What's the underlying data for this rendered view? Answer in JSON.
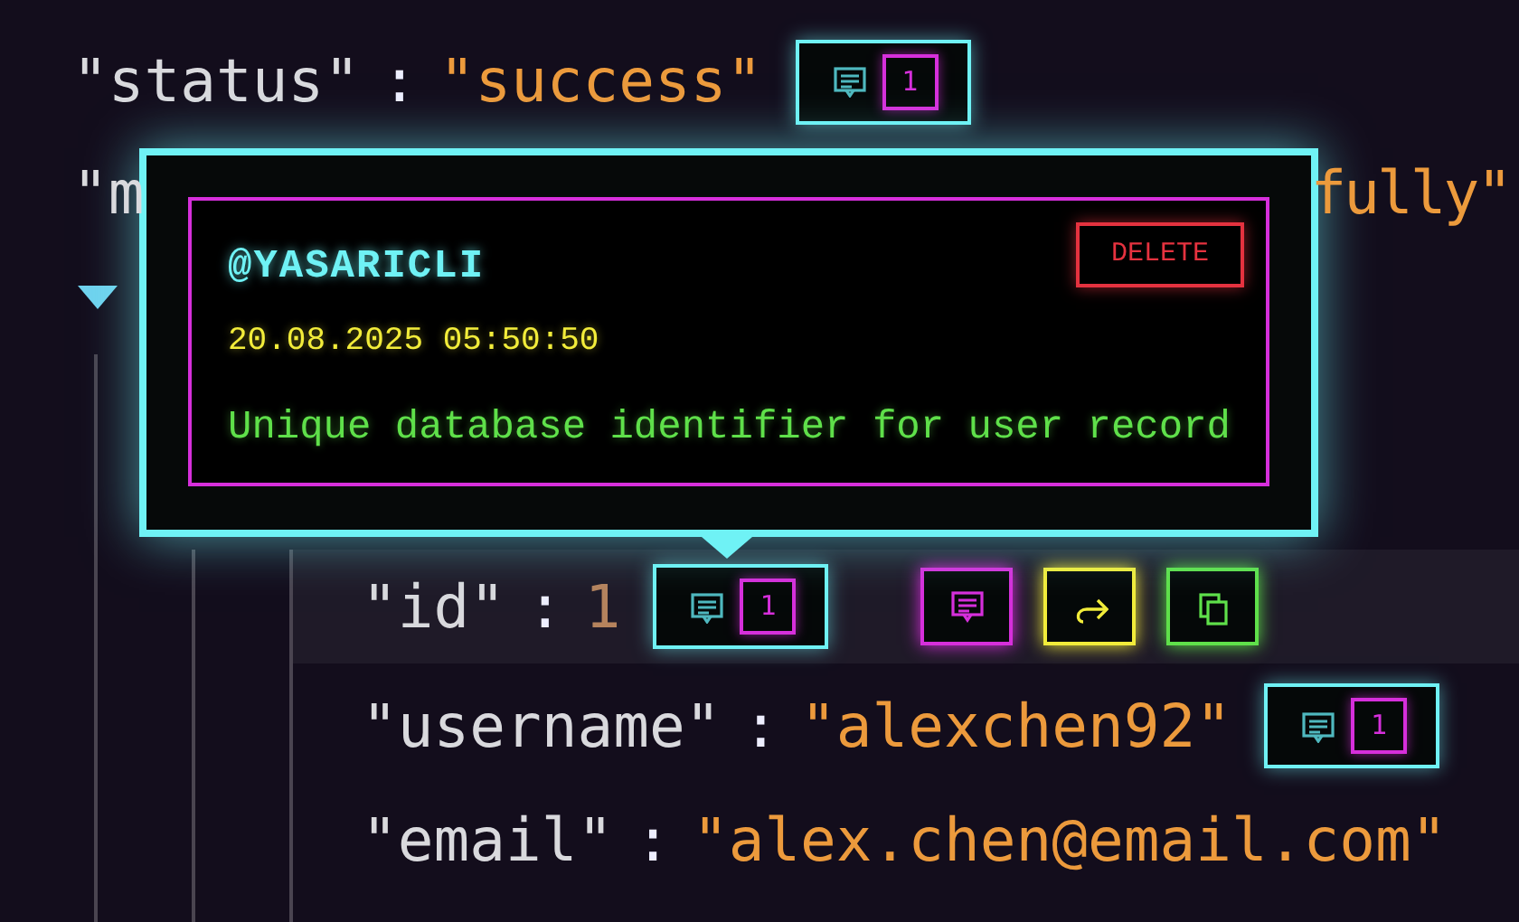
{
  "root_rows": [
    {
      "key": "\"status\"",
      "separator": ":",
      "value": "\"success\"",
      "kind": "string",
      "comment_count": "1"
    },
    {
      "key": "\"m",
      "value": "fully\"",
      "kind": "string"
    }
  ],
  "toggle": {
    "expanded": true
  },
  "nested_rows": [
    {
      "key": "\"id\"",
      "separator": ":",
      "value": "1",
      "kind": "number",
      "comment_count": "1",
      "hovered": true
    },
    {
      "key": "\"username\"",
      "separator": ":",
      "value": "\"alexchen92\"",
      "kind": "string",
      "comment_count": "1",
      "hovered": false
    },
    {
      "key": "\"email\"",
      "separator": ":",
      "value": "\"alex.chen@email.com\"",
      "kind": "string",
      "hovered": false
    }
  ],
  "row_actions": [
    {
      "kind": "comment"
    },
    {
      "kind": "share"
    },
    {
      "kind": "copy"
    }
  ],
  "comment_popup": {
    "author": "@YASARICLI",
    "timestamp": "20.08.2025 05:50:50",
    "text": "Unique database identifier for user record",
    "delete_label": "DELETE"
  }
}
